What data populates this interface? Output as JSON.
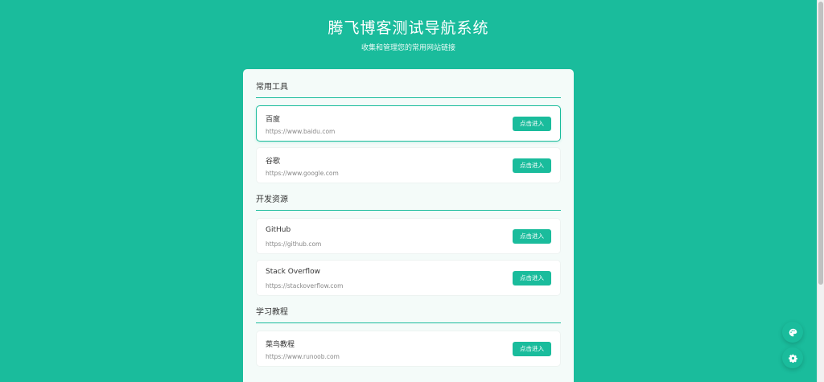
{
  "header": {
    "title": "腾飞博客测试导航系统",
    "subtitle": "收集和管理您的常用网站链接"
  },
  "button_label": "点击进入",
  "sections": [
    {
      "title": "常用工具",
      "links": [
        {
          "name": "百度",
          "url": "https://www.baidu.com"
        },
        {
          "name": "谷歌",
          "url": "https://www.google.com"
        }
      ]
    },
    {
      "title": "开发资源",
      "links": [
        {
          "name": "GitHub",
          "url": "https://github.com"
        },
        {
          "name": "Stack Overflow",
          "url": "https://stackoverflow.com"
        }
      ]
    },
    {
      "title": "学习教程",
      "links": [
        {
          "name": "菜鸟教程",
          "url": "https://www.runoob.com"
        }
      ]
    }
  ],
  "floating_buttons": {
    "theme": "palette-icon",
    "settings": "gear-icon"
  },
  "colors": {
    "accent": "#1abc9c",
    "background": "#1abc9c",
    "card": "#ffffff",
    "panel": "#f4fbf9"
  }
}
